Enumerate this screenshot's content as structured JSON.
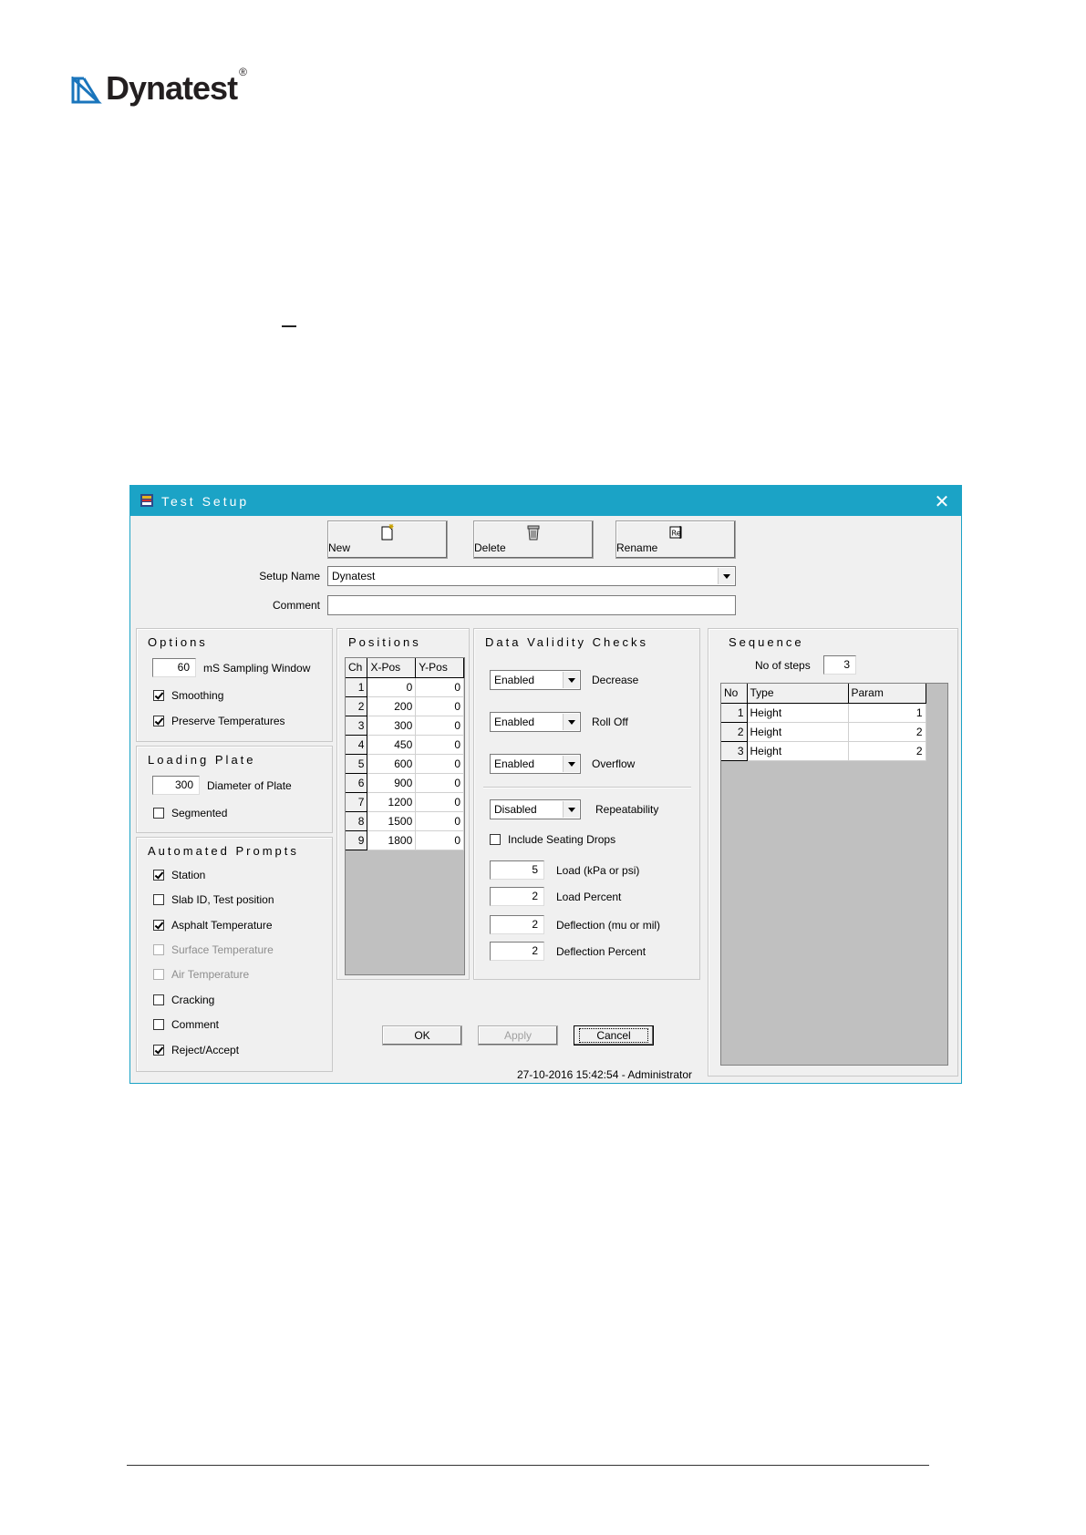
{
  "brand": {
    "logo_text": "Dynatest",
    "reg_mark": "®"
  },
  "window": {
    "title": "Test Setup",
    "close_glyph": "✕"
  },
  "toolbar": {
    "new_label": "New",
    "delete_label": "Delete",
    "rename_label": "Rename"
  },
  "setup": {
    "name_label": "Setup Name",
    "name_value": "Dynatest",
    "comment_label": "Comment",
    "comment_value": ""
  },
  "options": {
    "title": "Options",
    "sampling_value": "60",
    "sampling_label": "mS Sampling Window",
    "smoothing_label": "Smoothing",
    "smoothing_checked": true,
    "preserve_label": "Preserve Temperatures",
    "preserve_checked": true
  },
  "loading_plate": {
    "title": "Loading Plate",
    "diameter_value": "300",
    "diameter_label": "Diameter of Plate",
    "segmented_label": "Segmented",
    "segmented_checked": false
  },
  "prompts": {
    "title": "Automated Prompts",
    "items": [
      {
        "label": "Station",
        "checked": true,
        "enabled": true
      },
      {
        "label": "Slab ID, Test position",
        "checked": false,
        "enabled": true
      },
      {
        "label": "Asphalt Temperature",
        "checked": true,
        "enabled": true
      },
      {
        "label": "Surface Temperature",
        "checked": false,
        "enabled": false
      },
      {
        "label": "Air Temperature",
        "checked": false,
        "enabled": false
      },
      {
        "label": "Cracking",
        "checked": false,
        "enabled": true
      },
      {
        "label": "Comment",
        "checked": false,
        "enabled": true
      },
      {
        "label": "Reject/Accept",
        "checked": true,
        "enabled": true
      }
    ]
  },
  "positions": {
    "title": "Positions",
    "columns": [
      "Ch",
      "X-Pos",
      "Y-Pos"
    ],
    "rows": [
      [
        "1",
        "0",
        "0"
      ],
      [
        "2",
        "200",
        "0"
      ],
      [
        "3",
        "300",
        "0"
      ],
      [
        "4",
        "450",
        "0"
      ],
      [
        "5",
        "600",
        "0"
      ],
      [
        "6",
        "900",
        "0"
      ],
      [
        "7",
        "1200",
        "0"
      ],
      [
        "8",
        "1500",
        "0"
      ],
      [
        "9",
        "1800",
        "0"
      ]
    ]
  },
  "validity": {
    "title": "Data Validity Checks",
    "decrease_value": "Enabled",
    "decrease_label": "Decrease",
    "rolloff_value": "Enabled",
    "rolloff_label": "Roll Off",
    "overflow_value": "Enabled",
    "overflow_label": "Overflow",
    "repeat_value": "Disabled",
    "repeat_label": "Repeatability",
    "seating_label": "Include Seating Drops",
    "seating_checked": false,
    "load_value": "5",
    "load_label": "Load (kPa or psi)",
    "loadpct_value": "2",
    "loadpct_label": "Load Percent",
    "defl_value": "2",
    "defl_label": "Deflection (mu or mil)",
    "deflpct_value": "2",
    "deflpct_label": "Deflection Percent"
  },
  "sequence": {
    "title": "Sequence",
    "steps_label": "No of steps",
    "steps_value": "3",
    "columns": [
      "No",
      "Type",
      "Param"
    ],
    "rows": [
      [
        "1",
        "Height",
        "1"
      ],
      [
        "2",
        "Height",
        "2"
      ],
      [
        "3",
        "Height",
        "2"
      ]
    ]
  },
  "buttons": {
    "ok": "OK",
    "apply": "Apply",
    "cancel": "Cancel"
  },
  "status_text": "27-10-2016 15:42:54 - Administrator"
}
